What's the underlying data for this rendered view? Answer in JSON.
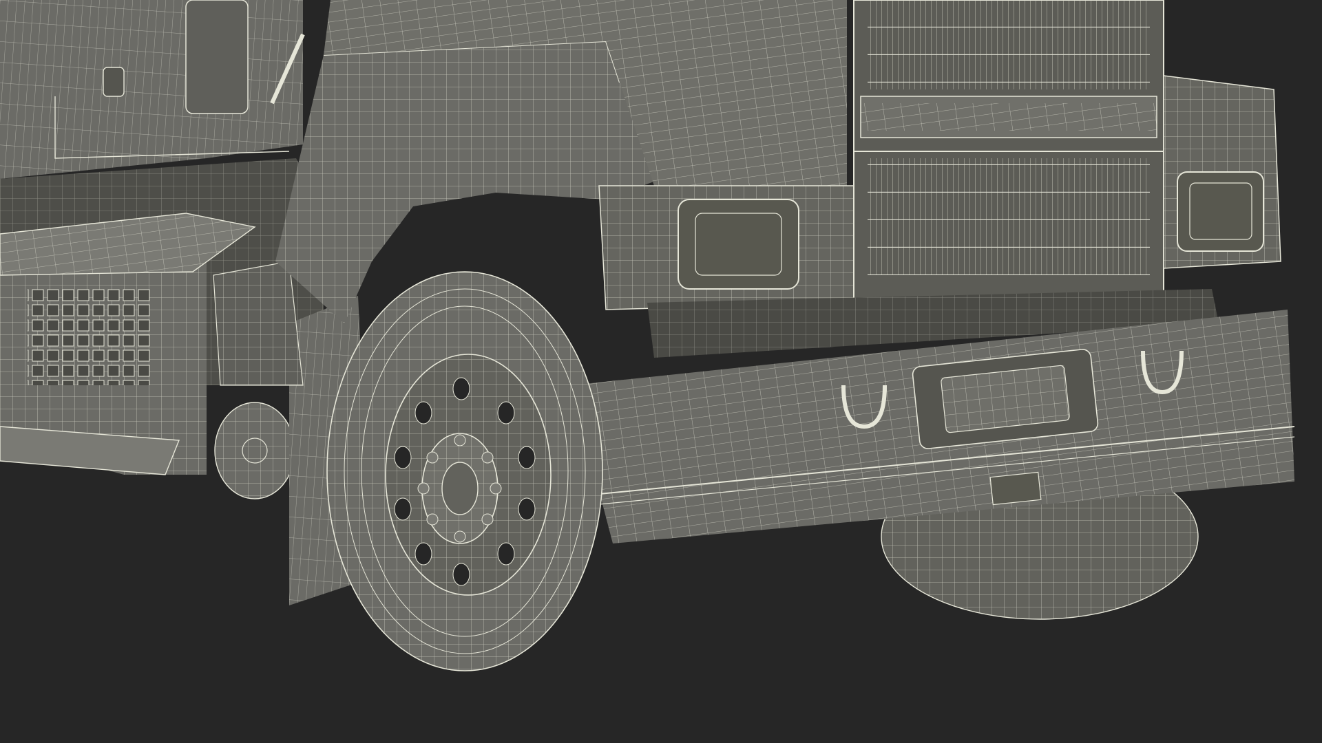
{
  "scene": {
    "background_color": "#262626",
    "model_fill_color": "#6b6b66",
    "model_fill_light": "#7a7a74",
    "model_fill_dark": "#55554f",
    "wire_color": "#e6e6d8",
    "shadow_color": "#444440",
    "subject": "wireframe-truck-front-render"
  }
}
